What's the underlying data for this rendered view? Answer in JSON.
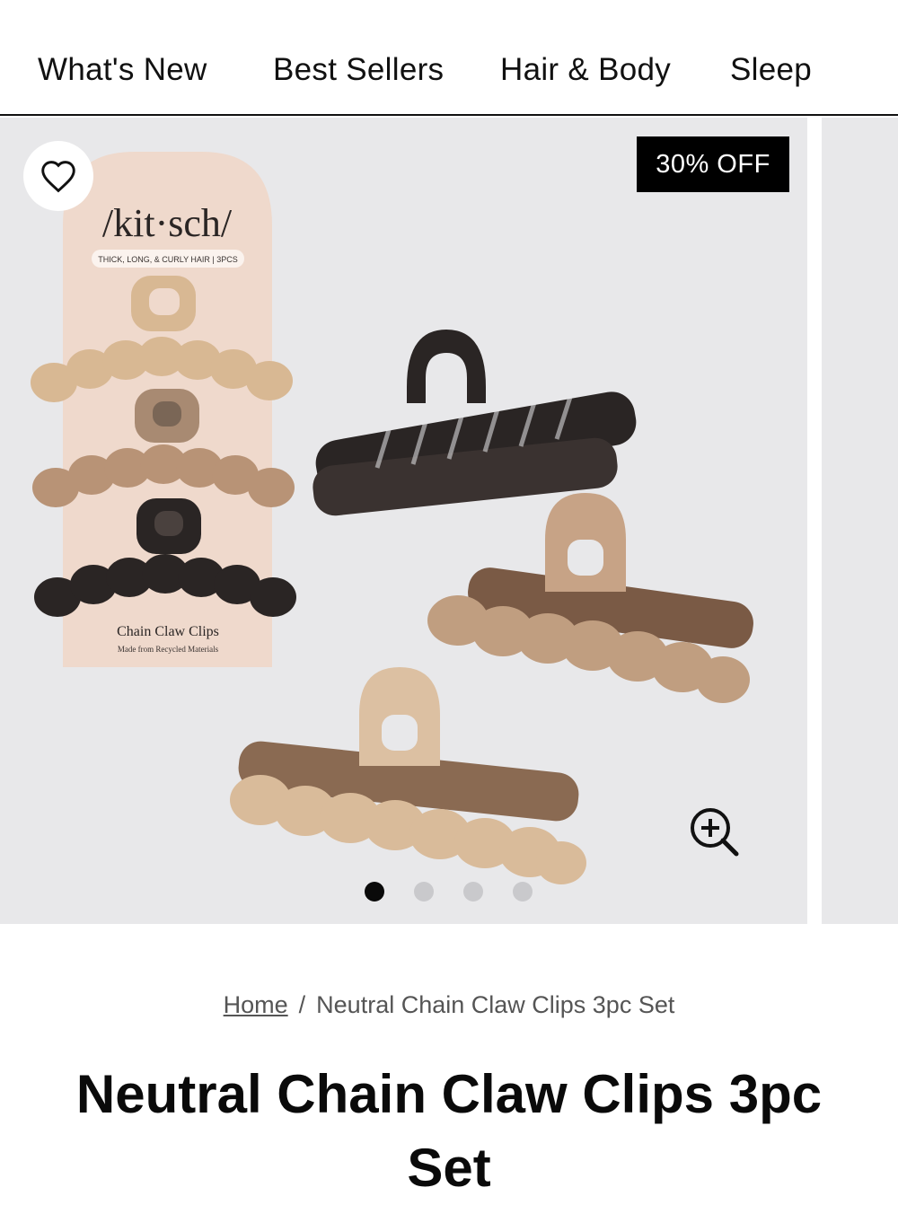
{
  "nav": {
    "items": [
      "What's New",
      "Best Sellers",
      "Hair & Body",
      "Sleep"
    ]
  },
  "gallery": {
    "badge": "30% OFF",
    "slide_count": 4,
    "active_slide": 1,
    "packaging": {
      "brand": "/kit·sch/",
      "tagline": "THICK, LONG, & CURLY HAIR | 3PCS",
      "product_name": "Chain Claw Clips",
      "subtext": "Made from Recycled Materials"
    },
    "colors": {
      "clip_beige": "#d8b893",
      "clip_taupe": "#b89376",
      "clip_black": "#2a2524",
      "card": "#efd9cc"
    }
  },
  "icons": {
    "wishlist": "heart-icon",
    "zoom": "zoom-in-icon"
  },
  "breadcrumb": {
    "home": "Home",
    "separator": "/",
    "current": "Neutral Chain Claw Clips 3pc Set"
  },
  "product": {
    "title": "Neutral Chain Claw Clips 3pc Set"
  }
}
